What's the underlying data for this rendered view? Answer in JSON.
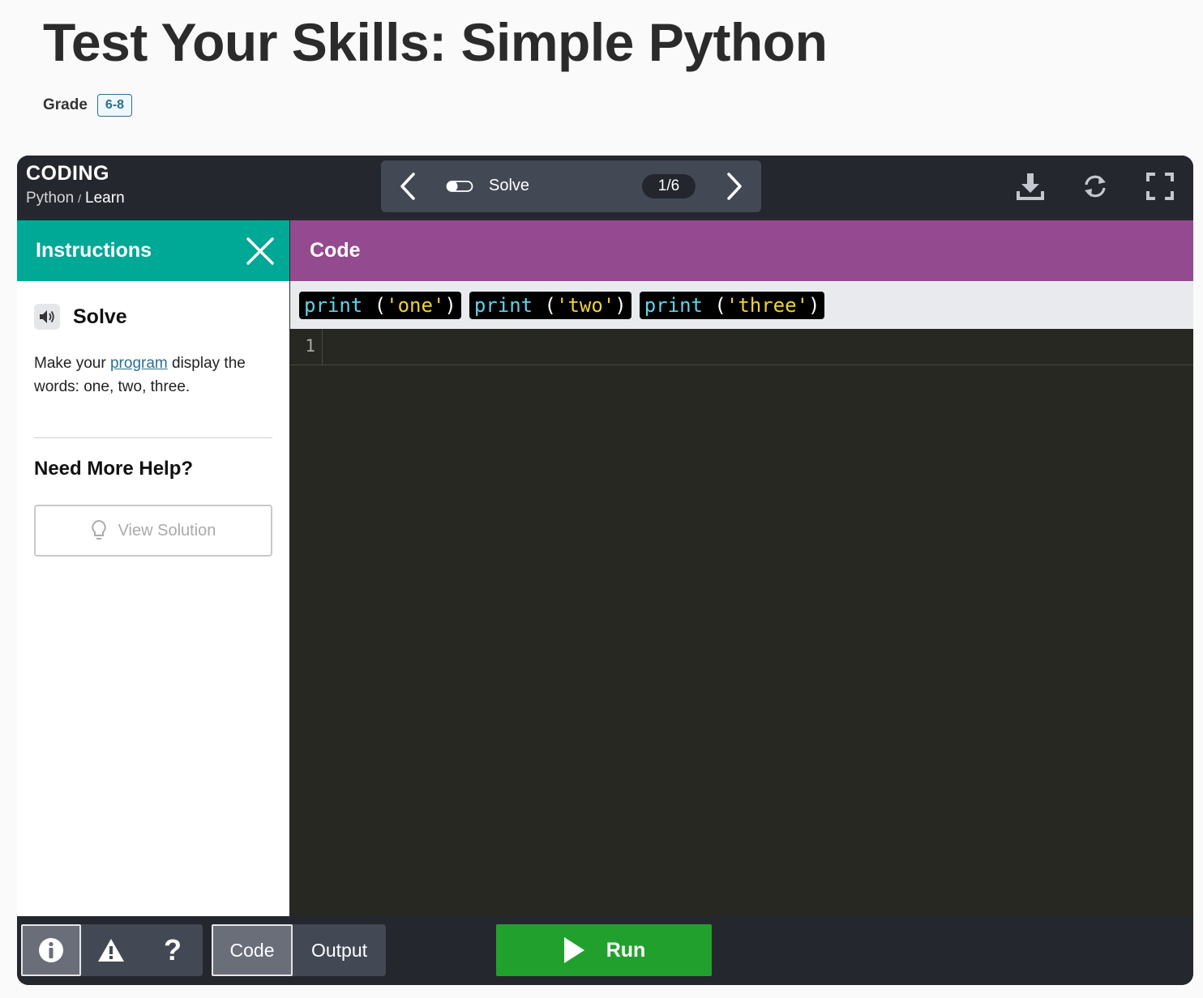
{
  "page": {
    "title": "Test Your Skills: Simple Python",
    "grade_label": "Grade",
    "grade_value": "6-8"
  },
  "topbar": {
    "brand": "CODING",
    "crumb_parent": "Python",
    "crumb_separator": "/",
    "crumb_current": "Learn",
    "step_label": "Solve",
    "step_count": "1/6",
    "icons": [
      "chevron-left-icon",
      "toggle-icon",
      "chevron-right-icon",
      "download-icon",
      "refresh-icon",
      "fullscreen-icon"
    ]
  },
  "instructions": {
    "header": "Instructions",
    "heading": "Solve",
    "text_before": "Make your ",
    "link_text": "program",
    "text_after": " display the words: one, two, three.",
    "help_heading": "Need More Help?",
    "solution_button": "View Solution"
  },
  "code": {
    "header": "Code",
    "blocks": [
      {
        "keyword": "print",
        "open": " (",
        "string": "'one'",
        "close": ")"
      },
      {
        "keyword": "print",
        "open": " (",
        "string": "'two'",
        "close": ")"
      },
      {
        "keyword": "print",
        "open": " (",
        "string": "'three'",
        "close": ")"
      }
    ],
    "line_numbers": [
      "1"
    ]
  },
  "bottombar": {
    "info_icon": "info-icon",
    "warning_icon": "warning-icon",
    "help_label": "?",
    "tab_code": "Code",
    "tab_output": "Output",
    "run_label": "Run"
  },
  "colors": {
    "instructions_header": "#00a896",
    "code_header": "#944a8e",
    "run_button": "#22a02e",
    "editor_bg": "#272822"
  }
}
